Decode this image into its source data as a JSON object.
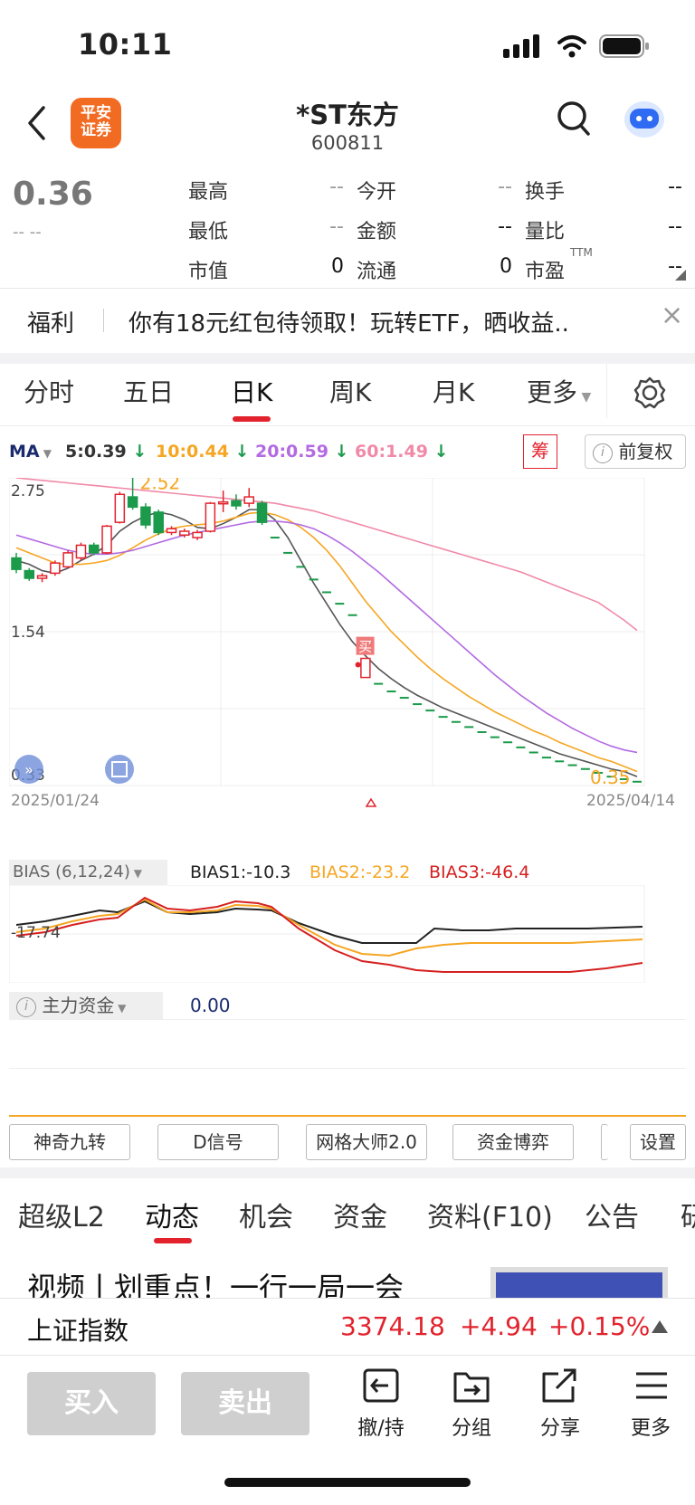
{
  "status": {
    "time": "10:11"
  },
  "nav": {
    "logo_line1": "平安",
    "logo_line2": "证券",
    "title": "*ST东方",
    "code": "600811"
  },
  "quote": {
    "price": "0.36",
    "change": "-- --",
    "fields": [
      {
        "label": "最高",
        "value": "--"
      },
      {
        "label": "今开",
        "value": "--"
      },
      {
        "label": "换手",
        "value": "--"
      },
      {
        "label": "最低",
        "value": "--"
      },
      {
        "label": "金额",
        "value": "--"
      },
      {
        "label": "量比",
        "value": "--"
      },
      {
        "label": "市值",
        "value": "0"
      },
      {
        "label": "流通",
        "value": "0"
      },
      {
        "label": "市盈",
        "value": "--"
      }
    ],
    "pe_sup": "TTM"
  },
  "banner": {
    "tag": "福利",
    "text": "你有18元红包待领取！玩转ETF，晒收益..",
    "close": "×"
  },
  "period_tabs": [
    "分时",
    "五日",
    "日K",
    "周K",
    "月K",
    "更多"
  ],
  "ma": {
    "label": "MA",
    "items": [
      {
        "text": "5:0.39",
        "color": "#333333"
      },
      {
        "text": "10:0.44",
        "color": "#f5a623"
      },
      {
        "text": "20:0.59",
        "color": "#b36ae2"
      },
      {
        "text": "60:1.49",
        "color": "#f08aa8"
      }
    ],
    "chou": "筹",
    "fuquan": "前复权"
  },
  "chart_data": {
    "type": "candlestick",
    "y_ticks": [
      "2.75",
      "1.54",
      "0.33"
    ],
    "x_start": "2025/01/24",
    "x_end": "2025/04/14",
    "high_label": "2.52",
    "low_label": "0.35",
    "buy_marker": "买",
    "ylim": [
      0.33,
      2.75
    ],
    "candles": [
      {
        "o": 2.12,
        "c": 2.03,
        "h": 2.16,
        "l": 2.0
      },
      {
        "o": 2.02,
        "c": 1.96,
        "h": 2.04,
        "l": 1.94
      },
      {
        "o": 1.96,
        "c": 1.98,
        "h": 2.0,
        "l": 1.93
      },
      {
        "o": 2.0,
        "c": 2.08,
        "h": 2.1,
        "l": 1.98
      },
      {
        "o": 2.05,
        "c": 2.16,
        "h": 2.18,
        "l": 2.04
      },
      {
        "o": 2.12,
        "c": 2.22,
        "h": 2.24,
        "l": 2.1
      },
      {
        "o": 2.22,
        "c": 2.16,
        "h": 2.24,
        "l": 2.14
      },
      {
        "o": 2.16,
        "c": 2.37,
        "h": 2.38,
        "l": 2.15
      },
      {
        "o": 2.4,
        "c": 2.62,
        "h": 2.64,
        "l": 2.39
      },
      {
        "o": 2.6,
        "c": 2.52,
        "h": 2.85,
        "l": 2.5
      },
      {
        "o": 2.52,
        "c": 2.38,
        "h": 2.55,
        "l": 2.35
      },
      {
        "o": 2.48,
        "c": 2.32,
        "h": 2.5,
        "l": 2.3
      },
      {
        "o": 2.32,
        "c": 2.35,
        "h": 2.37,
        "l": 2.3
      },
      {
        "o": 2.3,
        "c": 2.33,
        "h": 2.35,
        "l": 2.28
      },
      {
        "o": 2.28,
        "c": 2.32,
        "h": 2.34,
        "l": 2.26
      },
      {
        "o": 2.33,
        "c": 2.55,
        "h": 2.56,
        "l": 2.32
      },
      {
        "o": 2.56,
        "c": 2.56,
        "h": 2.65,
        "l": 2.48
      },
      {
        "o": 2.57,
        "c": 2.53,
        "h": 2.62,
        "l": 2.5
      },
      {
        "o": 2.55,
        "c": 2.6,
        "h": 2.67,
        "l": 2.52
      },
      {
        "o": 2.55,
        "c": 2.4,
        "h": 2.57,
        "l": 2.38
      },
      {
        "o": 2.28,
        "c": 2.28,
        "h": 2.28,
        "l": 2.28
      },
      {
        "o": 2.16,
        "c": 2.16,
        "h": 2.16,
        "l": 2.16
      },
      {
        "o": 2.05,
        "c": 2.05,
        "h": 2.05,
        "l": 2.05
      },
      {
        "o": 1.95,
        "c": 1.95,
        "h": 1.95,
        "l": 1.95
      },
      {
        "o": 1.85,
        "c": 1.85,
        "h": 1.85,
        "l": 1.85
      },
      {
        "o": 1.76,
        "c": 1.76,
        "h": 1.76,
        "l": 1.76
      },
      {
        "o": 1.67,
        "c": 1.67,
        "h": 1.67,
        "l": 1.67
      },
      {
        "o": 1.18,
        "c": 1.33,
        "h": 1.33,
        "l": 1.18
      },
      {
        "o": 1.13,
        "c": 1.13,
        "h": 1.13,
        "l": 1.13
      },
      {
        "o": 1.07,
        "c": 1.07,
        "h": 1.07,
        "l": 1.07
      },
      {
        "o": 1.02,
        "c": 1.02,
        "h": 1.02,
        "l": 1.02
      },
      {
        "o": 0.97,
        "c": 0.97,
        "h": 0.97,
        "l": 0.97
      },
      {
        "o": 0.92,
        "c": 0.92,
        "h": 0.92,
        "l": 0.92
      },
      {
        "o": 0.87,
        "c": 0.87,
        "h": 0.87,
        "l": 0.87
      },
      {
        "o": 0.83,
        "c": 0.83,
        "h": 0.83,
        "l": 0.83
      },
      {
        "o": 0.79,
        "c": 0.79,
        "h": 0.79,
        "l": 0.79
      },
      {
        "o": 0.75,
        "c": 0.75,
        "h": 0.75,
        "l": 0.75
      },
      {
        "o": 0.71,
        "c": 0.71,
        "h": 0.71,
        "l": 0.71
      },
      {
        "o": 0.67,
        "c": 0.67,
        "h": 0.67,
        "l": 0.67
      },
      {
        "o": 0.63,
        "c": 0.63,
        "h": 0.63,
        "l": 0.63
      },
      {
        "o": 0.59,
        "c": 0.59,
        "h": 0.59,
        "l": 0.59
      },
      {
        "o": 0.55,
        "c": 0.55,
        "h": 0.55,
        "l": 0.55
      },
      {
        "o": 0.52,
        "c": 0.52,
        "h": 0.52,
        "l": 0.52
      },
      {
        "o": 0.49,
        "c": 0.49,
        "h": 0.49,
        "l": 0.49
      },
      {
        "o": 0.46,
        "c": 0.46,
        "h": 0.46,
        "l": 0.46
      },
      {
        "o": 0.43,
        "c": 0.43,
        "h": 0.43,
        "l": 0.43
      },
      {
        "o": 0.4,
        "c": 0.4,
        "h": 0.4,
        "l": 0.4
      },
      {
        "o": 0.38,
        "c": 0.38,
        "h": 0.38,
        "l": 0.38
      },
      {
        "o": 0.36,
        "c": 0.36,
        "h": 0.36,
        "l": 0.36
      }
    ],
    "series": [
      {
        "name": "MA5",
        "color": "#555555",
        "values": [
          2.1,
          2.07,
          2.02,
          2.0,
          2.04,
          2.1,
          2.15,
          2.22,
          2.33,
          2.4,
          2.45,
          2.48,
          2.46,
          2.42,
          2.36,
          2.35,
          2.39,
          2.44,
          2.5,
          2.5,
          2.42,
          2.28,
          2.1,
          1.92,
          1.76,
          1.6,
          1.46,
          1.35,
          1.25,
          1.17,
          1.1,
          1.04,
          0.99,
          0.94,
          0.9,
          0.86,
          0.82,
          0.78,
          0.74,
          0.7,
          0.66,
          0.62,
          0.58,
          0.55,
          0.52,
          0.49,
          0.46,
          0.44,
          0.4
        ]
      },
      {
        "name": "MA10",
        "color": "#f5a623",
        "values": [
          2.2,
          2.16,
          2.12,
          2.08,
          2.07,
          2.07,
          2.08,
          2.1,
          2.14,
          2.2,
          2.26,
          2.31,
          2.35,
          2.37,
          2.38,
          2.39,
          2.41,
          2.44,
          2.47,
          2.48,
          2.46,
          2.42,
          2.36,
          2.28,
          2.18,
          2.06,
          1.92,
          1.78,
          1.66,
          1.54,
          1.44,
          1.34,
          1.25,
          1.17,
          1.1,
          1.03,
          0.97,
          0.91,
          0.86,
          0.81,
          0.76,
          0.72,
          0.67,
          0.63,
          0.59,
          0.55,
          0.52,
          0.48,
          0.44
        ]
      },
      {
        "name": "MA20",
        "color": "#b36ae2",
        "values": [
          2.3,
          2.27,
          2.24,
          2.21,
          2.18,
          2.16,
          2.15,
          2.15,
          2.16,
          2.18,
          2.21,
          2.24,
          2.27,
          2.3,
          2.32,
          2.34,
          2.36,
          2.38,
          2.4,
          2.41,
          2.41,
          2.4,
          2.38,
          2.35,
          2.3,
          2.24,
          2.17,
          2.09,
          2.01,
          1.92,
          1.83,
          1.74,
          1.65,
          1.56,
          1.47,
          1.38,
          1.29,
          1.2,
          1.12,
          1.04,
          0.97,
          0.9,
          0.84,
          0.78,
          0.73,
          0.68,
          0.64,
          0.61,
          0.59
        ]
      },
      {
        "name": "MA60",
        "color": "#f08aa8",
        "values": [
          2.75,
          2.74,
          2.73,
          2.72,
          2.71,
          2.7,
          2.69,
          2.68,
          2.67,
          2.66,
          2.65,
          2.64,
          2.63,
          2.62,
          2.61,
          2.6,
          2.59,
          2.58,
          2.57,
          2.56,
          2.55,
          2.53,
          2.51,
          2.49,
          2.46,
          2.43,
          2.4,
          2.37,
          2.34,
          2.31,
          2.28,
          2.25,
          2.22,
          2.19,
          2.16,
          2.13,
          2.1,
          2.07,
          2.04,
          2.01,
          1.97,
          1.93,
          1.89,
          1.85,
          1.81,
          1.77,
          1.7,
          1.63,
          1.55
        ]
      }
    ]
  },
  "bias": {
    "label": "BIAS (6,12,24)",
    "b1": "BIAS1:-10.3",
    "b2": "BIAS2:-23.2",
    "b3": "BIAS3:-46.4",
    "tick": "-17.74",
    "colors": {
      "b1": "#222222",
      "b2": "#f5a623",
      "b3": "#d62020"
    }
  },
  "zhuli": {
    "label": "主力资金",
    "value": "0.00"
  },
  "tools": [
    "神奇九转",
    "D信号",
    "网格大师2.0",
    "资金博弈",
    "设置"
  ],
  "bottom_tabs": [
    "超级L2",
    "动态",
    "机会",
    "资金",
    "资料(F10)",
    "公告",
    "研"
  ],
  "news": {
    "headline": "视频丨划重点！一行一局一会"
  },
  "index": {
    "name": "上证指数",
    "value": "3374.18",
    "change": "+4.94",
    "pct": "+0.15%"
  },
  "actions": {
    "buy": "买入",
    "sell": "卖出"
  },
  "toolbar": [
    {
      "label": "撤/持",
      "icon": "withdraw-icon"
    },
    {
      "label": "分组",
      "icon": "folder-icon"
    },
    {
      "label": "分享",
      "icon": "share-icon"
    },
    {
      "label": "更多",
      "icon": "menu-icon"
    }
  ]
}
